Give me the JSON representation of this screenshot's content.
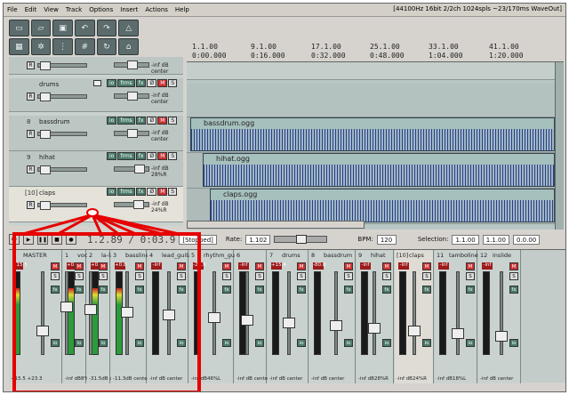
{
  "menu": [
    "File",
    "Edit",
    "View",
    "Track",
    "Options",
    "Insert",
    "Actions",
    "Help"
  ],
  "status": "[44100Hz 16bit 2/2ch 1024spls ~23/170ms WaveOut]",
  "toolbar_icons": [
    "new-icon",
    "open-icon",
    "save-icon",
    "undo-icon",
    "redo-icon",
    "metronome-icon",
    "grid-icon",
    "gear-icon",
    "snap-icon",
    "ripple-icon",
    "loop-icon",
    "lock-icon"
  ],
  "ruler": {
    "bars": [
      "1.1.00",
      "9.1.00",
      "17.1.00",
      "25.1.00",
      "33.1.00",
      "41.1.00"
    ],
    "times": [
      "0:00.000",
      "0:16.000",
      "0:32.000",
      "0:48.000",
      "1:04.000",
      "1:20.000"
    ]
  },
  "tcp": {
    "top_volume": "-inf dB center",
    "tracks": [
      {
        "num": "",
        "name": "drums",
        "vol": "-inf dB center"
      },
      {
        "num": "8",
        "name": "bassdrum",
        "vol": "-inf dB center"
      },
      {
        "num": "9",
        "name": "hihat",
        "vol": "-inf dB 28%R"
      },
      {
        "num": "[10]",
        "name": "claps",
        "vol": "-inf dB 24%R"
      }
    ],
    "btn_io": "io",
    "btn_fx": "fx",
    "btn_frms": "frms",
    "btn_m": "M",
    "btn_s": "S",
    "btn_r": "R"
  },
  "items": [
    {
      "name": "bassdrum.ogg"
    },
    {
      "name": "hihat.ogg"
    },
    {
      "name": "claps.ogg"
    }
  ],
  "transport": {
    "timecode": "1.2.89 / 0:03.9",
    "state": "[Stopped]",
    "rate_label": "Rate:",
    "rate_value": "1.102",
    "bpm_label": "BPM:",
    "bpm_value": "120",
    "selection_label": "Selection:",
    "sel_start": "1.1.00",
    "sel_end": "1.1.00",
    "sel_len": "0.0.00"
  },
  "mixer": {
    "strips": [
      {
        "num": "",
        "name": "MASTER",
        "peak": "+15.5",
        "foot": "+15.5 +23.3"
      },
      {
        "num": "1",
        "name": "vocal",
        "peak": "+0.8",
        "foot": "-inf dB8%R"
      },
      {
        "num": "2",
        "name": "la-la",
        "peak": "+0.8",
        "foot": "-31.5dB center"
      },
      {
        "num": "3",
        "name": "bassline",
        "peak": "+0.8",
        "foot": "-11.3dB center"
      },
      {
        "num": "4",
        "name": "lead_guitar",
        "peak": "-inf",
        "foot": "-inf dB center"
      },
      {
        "num": "5",
        "name": "rhythm_guitar",
        "peak": "-22.9",
        "foot": "-inf dB46%L"
      },
      {
        "num": "6",
        "name": "",
        "peak": "-inf",
        "foot": "-inf dB center"
      },
      {
        "num": "7",
        "name": "drums",
        "peak": "+15.4",
        "foot": "-inf dB center"
      },
      {
        "num": "8",
        "name": "bassdrum",
        "peak": "-80.8",
        "foot": "-inf dB center"
      },
      {
        "num": "9",
        "name": "hihat",
        "peak": "-inf",
        "foot": "-inf dB28%R"
      },
      {
        "num": "[10]",
        "name": "claps",
        "peak": "-inf",
        "foot": "-inf dB24%R"
      },
      {
        "num": "11",
        "name": "tamboline",
        "peak": "-inf",
        "foot": "-inf dB18%L"
      },
      {
        "num": "12",
        "name": "inslide",
        "peak": "-inf",
        "foot": "-inf dB center"
      }
    ],
    "scale": [
      "-inf",
      "-6",
      "-12",
      "-18",
      "-30",
      "-42",
      "-54"
    ]
  },
  "accent_color": "#e60000"
}
